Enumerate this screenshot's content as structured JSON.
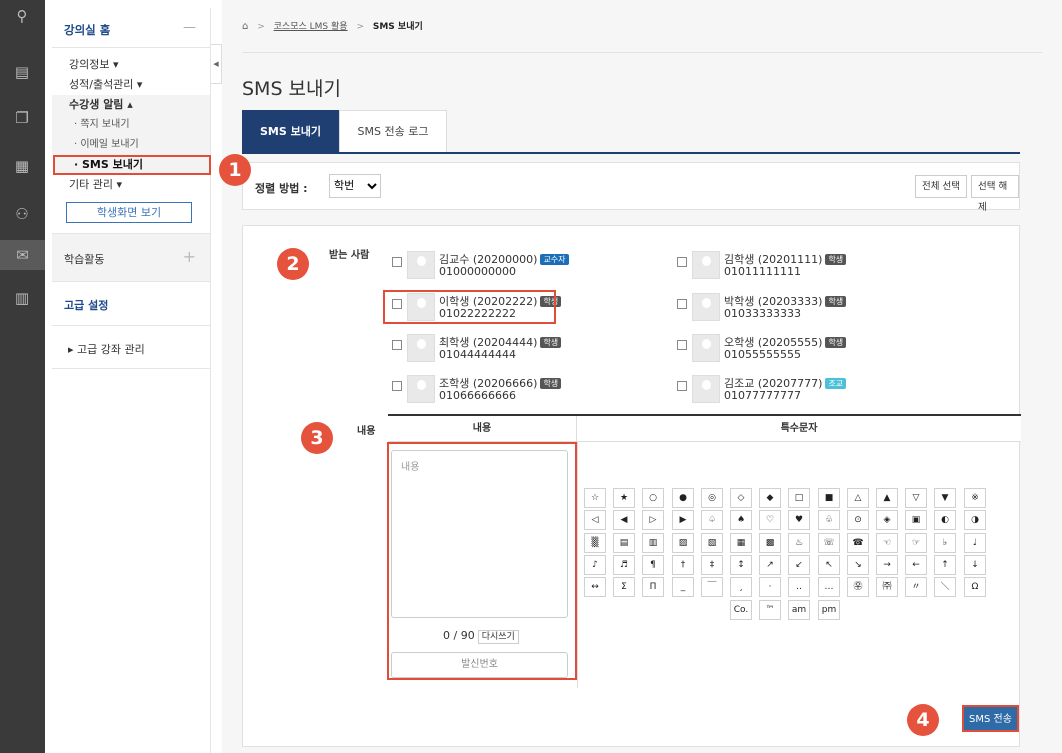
{
  "rail": {
    "icons": [
      "users-icon",
      "book-icon",
      "open-book-icon",
      "board-icon",
      "people-icon",
      "mail-icon",
      "map-icon"
    ]
  },
  "sidebar": {
    "title": "강의실 홈",
    "collapse_label": "—",
    "items": [
      {
        "label": "강의정보 ▾"
      },
      {
        "label": "성적/출석관리 ▾"
      },
      {
        "label": "수강생 알림 ▴"
      },
      {
        "label": "· 쪽지 보내기"
      },
      {
        "label": "· 이메일 보내기"
      },
      {
        "label": "· SMS 보내기"
      },
      {
        "label": "기타 관리 ▾"
      }
    ],
    "view_student_button": "학생화면 보기",
    "activity_label": "학습활동",
    "activity_plus": "+",
    "advanced_label": "고급 설정",
    "advanced_course": "▸  고급 강좌 관리"
  },
  "breadcrumb": {
    "home_icon": "⌂",
    "sep": ">",
    "item1": "코스모스 LMS 활용",
    "item2": "SMS 보내기"
  },
  "page_title": "SMS 보내기",
  "tabs": [
    {
      "label": "SMS 보내기"
    },
    {
      "label": "SMS 전송 로그"
    }
  ],
  "sort": {
    "label": "정렬 방법 :",
    "value": "학번",
    "select_all": "전체 선택",
    "deselect": "선택 해제"
  },
  "recipients": {
    "label": "받는 사람",
    "list": [
      {
        "name": "김교수 (20200000)",
        "phone": "01000000000",
        "role": "교수자"
      },
      {
        "name": "김학생 (20201111)",
        "phone": "01011111111",
        "role": "학생"
      },
      {
        "name": "이학생 (20202222)",
        "phone": "01022222222",
        "role": "학생"
      },
      {
        "name": "박학생 (20203333)",
        "phone": "01033333333",
        "role": "학생"
      },
      {
        "name": "최학생 (20204444)",
        "phone": "01044444444",
        "role": "학생"
      },
      {
        "name": "오학생 (20205555)",
        "phone": "01055555555",
        "role": "학생"
      },
      {
        "name": "조학생 (20206666)",
        "phone": "01066666666",
        "role": "학생"
      },
      {
        "name": "김조교 (20207777)",
        "phone": "01077777777",
        "role": "조교"
      }
    ]
  },
  "content": {
    "label": "내용",
    "col_content": "내용",
    "col_special": "특수문자",
    "placeholder": "내용",
    "counter": "0 / 90",
    "rewrite": "다시쓰기",
    "sender_number": "발신번호"
  },
  "symbols": [
    [
      "☆",
      "★",
      "○",
      "●",
      "◎",
      "◇",
      "◆",
      "□",
      "■",
      "△",
      "▲",
      "▽",
      "▼",
      "※"
    ],
    [
      "◁",
      "◀",
      "▷",
      "▶",
      "♤",
      "♠",
      "♡",
      "♥",
      "♧",
      "⊙",
      "◈",
      "▣",
      "◐",
      "◑"
    ],
    [
      "▒",
      "▤",
      "▥",
      "▨",
      "▧",
      "▦",
      "▩",
      "♨",
      "☏",
      "☎",
      "☜",
      "☞",
      "♭",
      "♩"
    ],
    [
      "♪",
      "♬",
      "¶",
      "†",
      "‡",
      "↕",
      "↗",
      "↙",
      "↖",
      "↘",
      "→",
      "←",
      "↑",
      "↓"
    ],
    [
      "↔",
      "Σ",
      "Π",
      "_",
      "￣",
      "¸",
      "·",
      "‥",
      "…",
      "㉾",
      "㈜",
      "〃",
      "＼",
      "Ω"
    ],
    [
      "Co.",
      "™",
      "am",
      "pm"
    ]
  ],
  "send_button": "SMS 전송",
  "steps": [
    "1",
    "2",
    "3",
    "4"
  ]
}
